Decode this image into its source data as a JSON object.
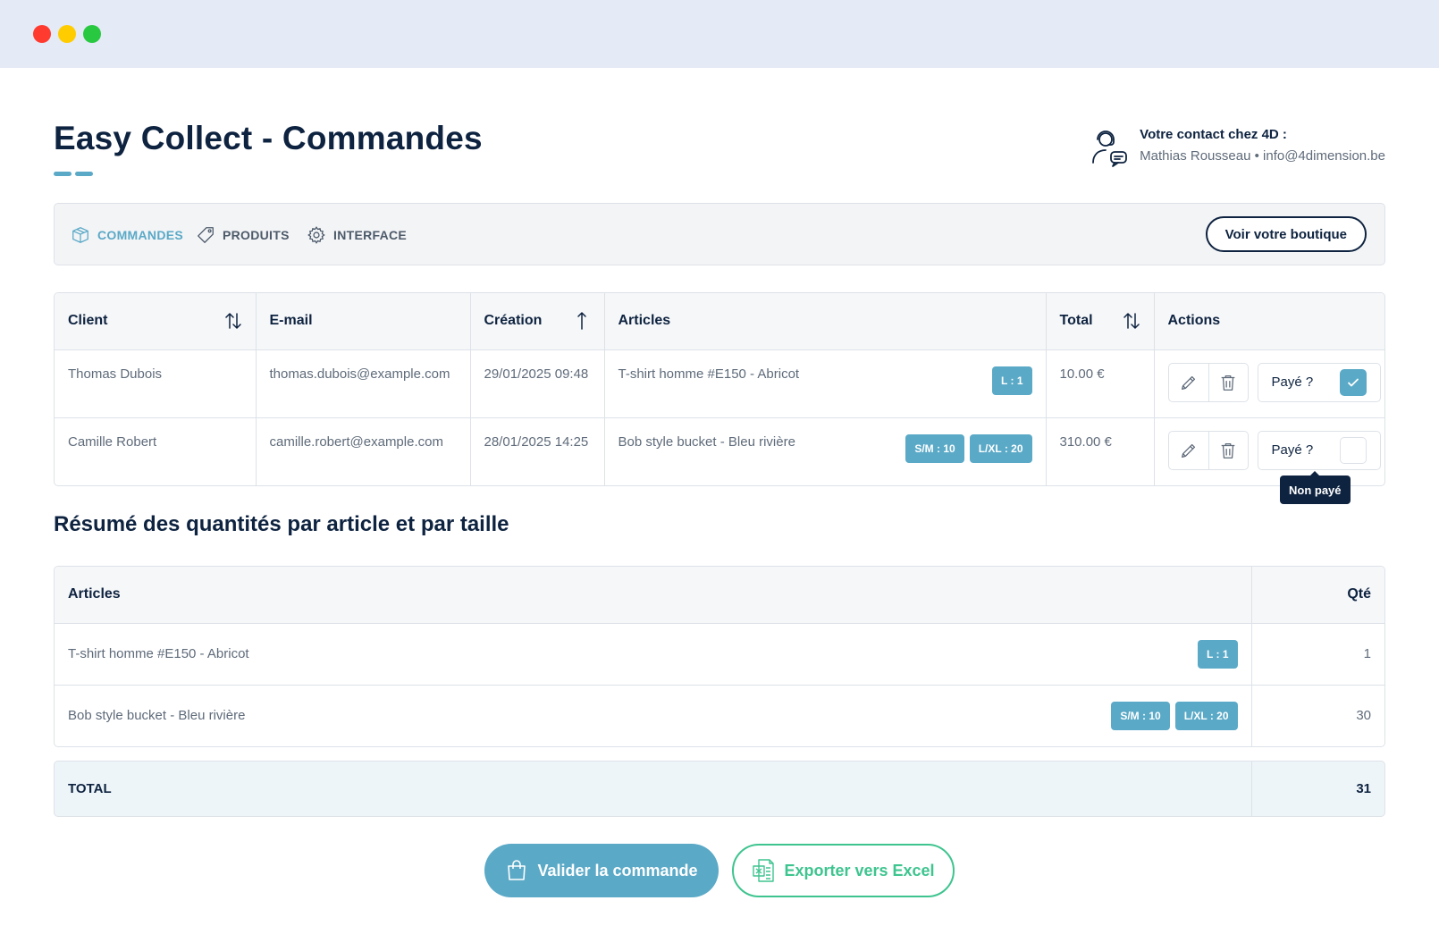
{
  "window": {
    "controls": [
      "close",
      "minimize",
      "maximize"
    ]
  },
  "header": {
    "title": "Easy Collect - Commandes",
    "contact_title": "Votre contact chez 4D :",
    "contact_name": "Mathias Rousseau",
    "contact_separator": "•",
    "contact_email": "info@4dimension.be"
  },
  "nav": {
    "items": [
      {
        "label": "COMMANDES",
        "icon": "box-icon",
        "active": true
      },
      {
        "label": "PRODUITS",
        "icon": "tag-icon",
        "active": false
      },
      {
        "label": "INTERFACE",
        "icon": "gear-icon",
        "active": false
      }
    ],
    "shop_button": "Voir votre boutique"
  },
  "orders": {
    "columns": [
      "Client",
      "E-mail",
      "Création",
      "Articles",
      "Total",
      "Actions"
    ],
    "rows": [
      {
        "client": "Thomas Dubois",
        "email": "thomas.dubois@example.com",
        "created": "29/01/2025 09:48",
        "article": "T-shirt homme #E150 - Abricot",
        "sizes": [
          "L : 1"
        ],
        "total": "10.00 €",
        "paid_label": "Payé ?",
        "paid": true
      },
      {
        "client": "Camille Robert",
        "email": "camille.robert@example.com",
        "created": "28/01/2025 14:25",
        "article": "Bob style bucket - Bleu rivière",
        "sizes": [
          "S/M : 10",
          "L/XL : 20"
        ],
        "total": "310.00 €",
        "paid_label": "Payé ?",
        "paid": false
      }
    ],
    "tooltip": "Non payé"
  },
  "summary": {
    "title": "Résumé des quantités par article et par taille",
    "columns": [
      "Articles",
      "Qté"
    ],
    "rows": [
      {
        "article": "T-shirt homme #E150 - Abricot",
        "sizes": [
          "L : 1"
        ],
        "qty": "1"
      },
      {
        "article": "Bob style bucket - Bleu rivière",
        "sizes": [
          "S/M : 10",
          "L/XL : 20"
        ],
        "qty": "30"
      }
    ],
    "total_label": "TOTAL",
    "total_value": "31"
  },
  "buttons": {
    "validate": "Valider la commande",
    "export": "Exporter vers Excel"
  },
  "colors": {
    "accent": "#5aa9c7",
    "navy": "#0e2340",
    "excel_green": "#3ec48f"
  }
}
